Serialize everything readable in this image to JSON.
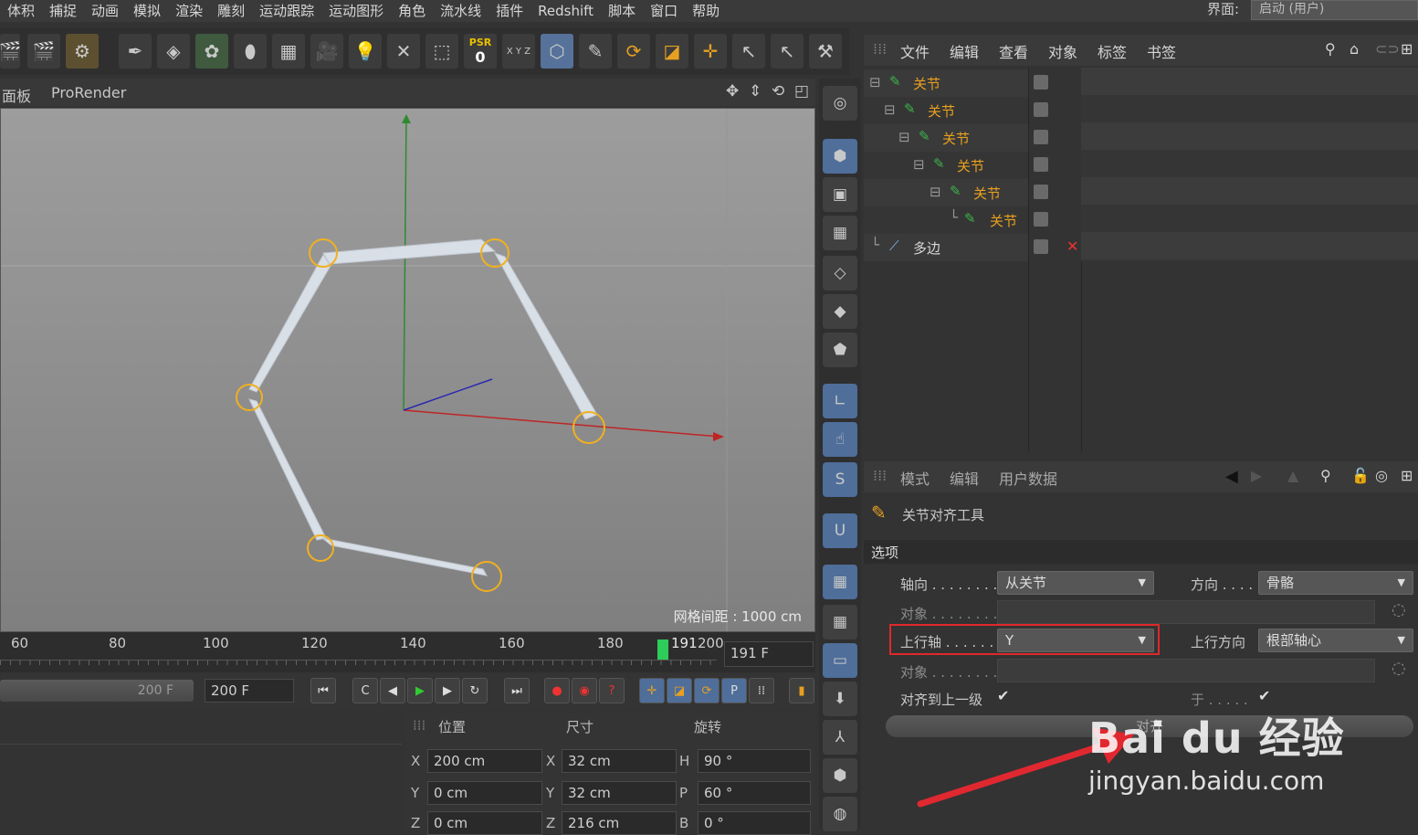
{
  "menubar": {
    "items": [
      "体积",
      "捕捉",
      "动画",
      "模拟",
      "渲染",
      "雕刻",
      "运动跟踪",
      "运动图形",
      "角色",
      "流水线",
      "插件",
      "Redshift",
      "脚本",
      "窗口",
      "帮助"
    ],
    "layout_label": "界面:",
    "layout_value": "启动 (用户)"
  },
  "toolbar": {
    "psr_label": "PSR",
    "psr_value": "0",
    "xyz_label": "X Y Z"
  },
  "viewport": {
    "tabs": [
      "面板",
      "ProRender"
    ],
    "grid_spacing": "网格间距 : 1000 cm"
  },
  "timeline": {
    "ticks": [
      "60",
      "80",
      "100",
      "120",
      "140",
      "160",
      "180"
    ],
    "current_frame": "191",
    "end_marker": "200",
    "frame_field": "191 F"
  },
  "transport": {
    "end_slider": "200 F",
    "max_field": "200 F"
  },
  "coords": {
    "headers": [
      "位置",
      "尺寸",
      "旋转"
    ],
    "pos": [
      {
        "axis": "X",
        "value": "200 cm"
      },
      {
        "axis": "Y",
        "value": "0 cm"
      },
      {
        "axis": "Z",
        "value": "0 cm"
      }
    ],
    "size": [
      {
        "axis": "X",
        "value": "32 cm"
      },
      {
        "axis": "Y",
        "value": "32 cm"
      },
      {
        "axis": "Z",
        "value": "216 cm"
      }
    ],
    "rot": [
      {
        "axis": "H",
        "value": "90 °"
      },
      {
        "axis": "P",
        "value": "60 °"
      },
      {
        "axis": "B",
        "value": "0 °"
      }
    ]
  },
  "object_manager": {
    "menu": [
      "文件",
      "编辑",
      "查看",
      "对象",
      "标签",
      "书签"
    ],
    "rows": [
      {
        "name": "关节",
        "depth": 0
      },
      {
        "name": "关节",
        "depth": 1
      },
      {
        "name": "关节",
        "depth": 2
      },
      {
        "name": "关节",
        "depth": 3
      },
      {
        "name": "关节",
        "depth": 4
      },
      {
        "name": "关节",
        "depth": 5
      },
      {
        "name": "多边",
        "depth": 0
      }
    ]
  },
  "attribute_manager": {
    "menu": [
      "模式",
      "编辑",
      "用户数据"
    ],
    "tool_title": "关节对齐工具",
    "section": "选项",
    "axis_label": "轴向 . . . . . . . .",
    "axis_value": "从关节",
    "dir_label": "方向 . . . .",
    "dir_value": "骨骼",
    "obj1_label": "对象 . . . . . . . .",
    "up_axis_label": "上行轴 . . . . . .",
    "up_axis_value": "Y",
    "up_dir_label": "上行方向",
    "up_dir_value": "根部轴心",
    "obj2_label": "对象 . . . . . . . .",
    "align_parent_label": "对齐到上一级",
    "extra_label": "于 . . . . .",
    "apply_button": "对齐"
  },
  "watermark": {
    "brand": "Bai du 经验",
    "url": "jingyan.baidu.com"
  },
  "colors": {
    "highlight_box": "#e0282a",
    "arrow": "#e02830",
    "joint_name": "#e8a020",
    "blue_button": "#4f6e9a"
  }
}
